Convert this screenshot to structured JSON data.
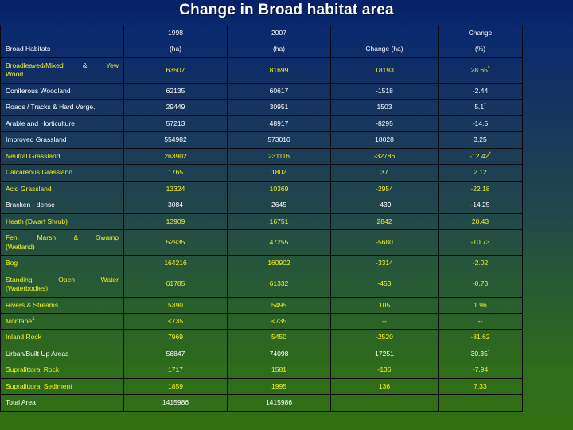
{
  "slide": {
    "title": "Change in Broad habitat area"
  },
  "table": {
    "headers": {
      "col0_top": "",
      "col0_bottom": "Broad Habitats",
      "col1_top": "1998",
      "col1_bottom": "(ha)",
      "col2_top": "2007",
      "col2_bottom": "(ha)",
      "col3_top": "",
      "col3_bottom": "Change (ha)",
      "col4_top": "Change",
      "col4_bottom": "(%)"
    },
    "rows": [
      {
        "habitat_line1": "Broadleaved/Mixed   &   Yew",
        "habitat_line2": "Wood.",
        "y1998": "63507",
        "y2007": "81699",
        "change_ha": "18193",
        "change_pct": "28.65",
        "pct_mark": "*",
        "color": "yellow"
      },
      {
        "habitat_line1": "Coniferous Woodland",
        "habitat_line2": "",
        "y1998": "62135",
        "y2007": "60617",
        "change_ha": "-1518",
        "change_pct": "-2.44",
        "pct_mark": "",
        "color": "white"
      },
      {
        "habitat_line1": "Roads / Tracks & Hard Verge.",
        "habitat_line2": "",
        "y1998": "29449",
        "y2007": "30951",
        "change_ha": "1503",
        "change_pct": "5.1",
        "pct_mark": "*",
        "color": "white"
      },
      {
        "habitat_line1": "Arable and Horticulture",
        "habitat_line2": "",
        "y1998": "57213",
        "y2007": "48917",
        "change_ha": "-8295",
        "change_pct": "-14.5",
        "pct_mark": "",
        "color": "white"
      },
      {
        "habitat_line1": "Improved Grassland",
        "habitat_line2": "",
        "y1998": "554982",
        "y2007": "573010",
        "change_ha": "18028",
        "change_pct": "3.25",
        "pct_mark": "",
        "color": "white"
      },
      {
        "habitat_line1": "Neutral Grassland",
        "habitat_line2": "",
        "y1998": "263902",
        "y2007": "231116",
        "change_ha": "-32786",
        "change_pct": "-12.42",
        "pct_mark": "*",
        "color": "yellow"
      },
      {
        "habitat_line1": "Calcareous Grassland",
        "habitat_line2": "",
        "y1998": "1765",
        "y2007": "1802",
        "change_ha": "37",
        "change_pct": "2.12",
        "pct_mark": "",
        "color": "yellow"
      },
      {
        "habitat_line1": "Acid Grassland",
        "habitat_line2": "",
        "y1998": "13324",
        "y2007": "10369",
        "change_ha": "-2954",
        "change_pct": "-22.18",
        "pct_mark": "",
        "color": "yellow"
      },
      {
        "habitat_line1": "Bracken - dense",
        "habitat_line2": "",
        "y1998": "3084",
        "y2007": "2645",
        "change_ha": "-439",
        "change_pct": "-14.25",
        "pct_mark": "",
        "color": "white"
      },
      {
        "habitat_line1": "Heath (Dwarf  Shrub)",
        "habitat_line2": "",
        "y1998": "13909",
        "y2007": "16751",
        "change_ha": "2842",
        "change_pct": "20.43",
        "pct_mark": "",
        "color": "yellow"
      },
      {
        "habitat_line1": "Fen,     Marsh     &     Swamp",
        "habitat_line2": "(Wetland)",
        "y1998": "52935",
        "y2007": "47255",
        "change_ha": "-5680",
        "change_pct": "-10.73",
        "pct_mark": "",
        "color": "yellow"
      },
      {
        "habitat_line1": "Bog",
        "habitat_line2": "",
        "y1998": "164216",
        "y2007": "160902",
        "change_ha": "-3314",
        "change_pct": "-2.02",
        "pct_mark": "",
        "color": "yellow"
      },
      {
        "habitat_line1": "Standing      Open      Water",
        "habitat_line2": "(Waterbodies)",
        "y1998": "61785",
        "y2007": "61332",
        "change_ha": "-453",
        "change_pct": "-0.73",
        "pct_mark": "",
        "color": "yellow"
      },
      {
        "habitat_line1": "Rivers & Streams",
        "habitat_line2": "",
        "y1998": "5390",
        "y2007": "5495",
        "change_ha": "105",
        "change_pct": "1.96",
        "pct_mark": "",
        "color": "yellow"
      },
      {
        "habitat_line1": "Montane",
        "habitat_line2": "",
        "habitat_mark": "1",
        "y1998": "<735",
        "y2007": "<735",
        "change_ha": "--",
        "change_pct": "--",
        "pct_mark": "",
        "color": "yellow"
      },
      {
        "habitat_line1": "Inland Rock",
        "habitat_line2": "",
        "y1998": "7969",
        "y2007": "5450",
        "change_ha": "-2520",
        "change_pct": "-31.62",
        "pct_mark": "",
        "color": "yellow"
      },
      {
        "habitat_line1": "Urban/Built Up Areas",
        "habitat_line2": "",
        "y1998": "56847",
        "y2007": "74098",
        "change_ha": "17251",
        "change_pct": "30.35",
        "pct_mark": "*",
        "color": "white"
      },
      {
        "habitat_line1": "Supralittoral Rock",
        "habitat_line2": "",
        "y1998": "1717",
        "y2007": "1581",
        "change_ha": "-136",
        "change_pct": "-7.94",
        "pct_mark": "",
        "color": "yellow"
      },
      {
        "habitat_line1": "Supralittoral Sediment",
        "habitat_line2": "",
        "y1998": "1859",
        "y2007": "1995",
        "change_ha": "136",
        "change_pct": "7.33",
        "pct_mark": "",
        "color": "yellow"
      },
      {
        "habitat_line1": "Total Area",
        "habitat_line2": "",
        "y1998": "1415986",
        "y2007": "1415986",
        "change_ha": "",
        "change_pct": "",
        "pct_mark": "",
        "color": "white"
      }
    ]
  },
  "colors": {
    "highlight_text": "#f3f31f",
    "normal_text": "#ffffff",
    "grid_line": "#07090e",
    "bg_top": "#062069",
    "bg_bottom": "#336f12"
  }
}
